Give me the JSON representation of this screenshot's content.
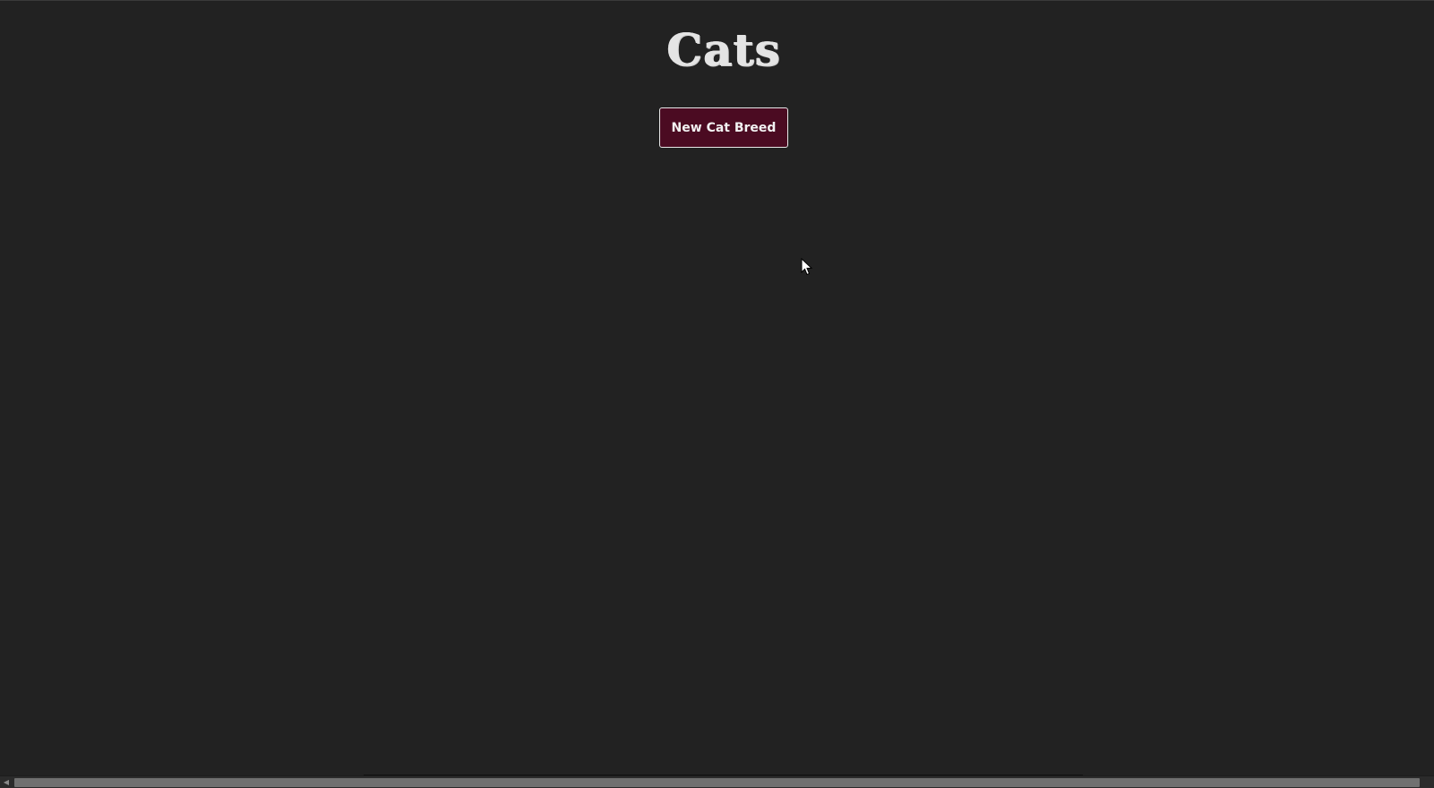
{
  "page": {
    "title": "Cats"
  },
  "actions": {
    "new_breed_label": "New Cat Breed"
  },
  "colors": {
    "background": "#222222",
    "title_text": "#e4e4e4",
    "button_background": "#4b0b22",
    "button_border": "#e8e8e8",
    "button_text": "#f2f2f2"
  },
  "icons": {
    "cursor": "mouse-cursor-icon",
    "scroll_left": "scroll-left-arrow-icon"
  }
}
